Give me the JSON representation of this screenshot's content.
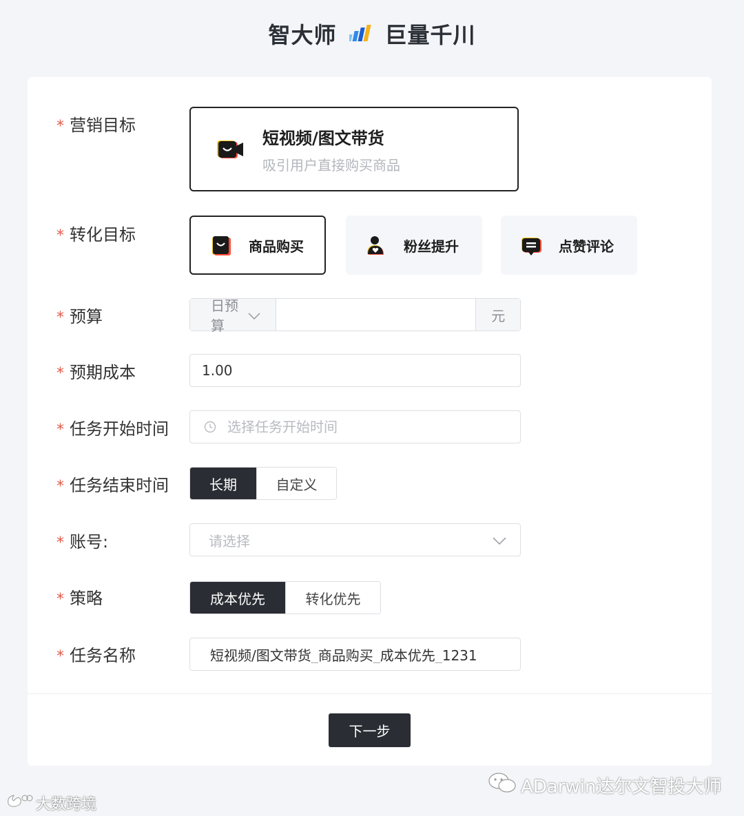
{
  "header": {
    "brand_left": "智大师",
    "brand_right": "巨量千川"
  },
  "form": {
    "marketing_goal": {
      "label": "营销目标",
      "required_mark": "*",
      "option_title": "短视频/图文带货",
      "option_desc": "吸引用户直接购买商品"
    },
    "conversion_goal": {
      "label": "转化目标",
      "required_mark": "*",
      "options": [
        {
          "label": "商品购买",
          "selected": true,
          "icon": "shopping-bag-icon"
        },
        {
          "label": "粉丝提升",
          "selected": false,
          "icon": "user-heart-icon"
        },
        {
          "label": "点赞评论",
          "selected": false,
          "icon": "comment-icon"
        }
      ]
    },
    "budget": {
      "label": "预算",
      "required_mark": "*",
      "type_selected": "日预算",
      "value": "",
      "unit": "元"
    },
    "expected_cost": {
      "label": "预期成本",
      "required_mark": "*",
      "value": "1.00"
    },
    "start_time": {
      "label": "任务开始时间",
      "required_mark": "*",
      "placeholder": "选择任务开始时间"
    },
    "end_time": {
      "label": "任务结束时间",
      "required_mark": "*",
      "options": [
        "长期",
        "自定义"
      ],
      "selected": "长期"
    },
    "account": {
      "label": "账号:",
      "required_mark": "*",
      "placeholder": "请选择"
    },
    "strategy": {
      "label": "策略",
      "required_mark": "*",
      "options": [
        "成本优先",
        "转化优先"
      ],
      "selected": "成本优先"
    },
    "task_name": {
      "label": "任务名称",
      "required_mark": "*",
      "value": "短视频/图文带货_商品购买_成本优先_1231"
    }
  },
  "actions": {
    "next_label": "下一步"
  },
  "watermarks": {
    "left": "大数跨境",
    "right": "ADarwin达尔文智投大师"
  },
  "colors": {
    "accent_dark": "#2a2d33",
    "required": "#e25a4a",
    "icon_yellow": "#f5c518",
    "icon_red": "#ff4d3a"
  }
}
